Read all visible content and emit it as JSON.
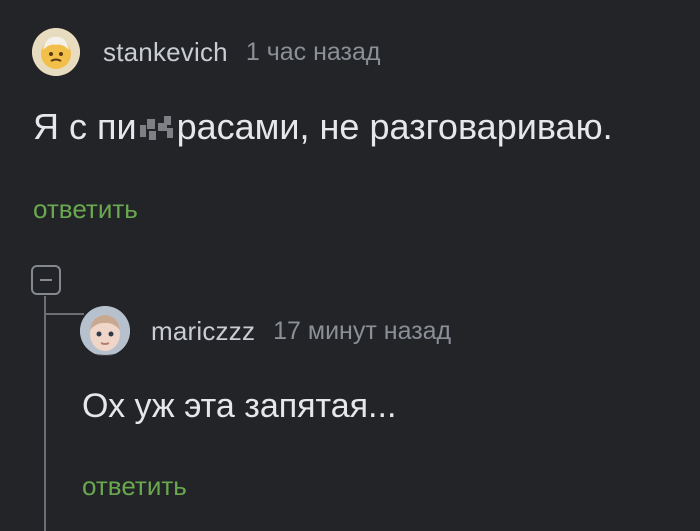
{
  "comment": {
    "author": "stankevich",
    "time": "1 час назад",
    "text_before": "Я с пи",
    "text_after": "расами, не разговариваю.",
    "reply_label": "ответить"
  },
  "reply": {
    "author": "mariczzz",
    "time": "17 минут назад",
    "text": "Ох уж эта запятая...",
    "reply_label": "ответить"
  },
  "colors": {
    "background": "#232428",
    "reply_link": "#6aa84f",
    "text": "#e6e7ea",
    "muted": "#8b8f96"
  }
}
